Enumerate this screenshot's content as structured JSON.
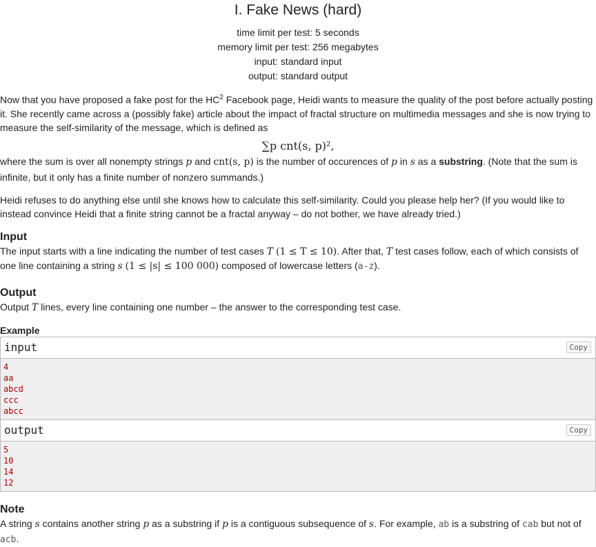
{
  "problem": {
    "title": "I. Fake News (hard)",
    "time_limit": "time limit per test: 5 seconds",
    "memory_limit": "memory limit per test: 256 megabytes",
    "input": "input: standard input",
    "output": "output: standard output"
  },
  "statement": {
    "p1a": "Now that you have proposed a fake post for the HC",
    "p1sup": "2",
    "p1b": " Facebook page, Heidi wants to measure the quality of the post before actually posting it. She recently came across a (possibly fake) article about the impact of fractal structure on multimedia messages and she is now trying to measure the self-similarity of the message, which is defined as",
    "formula": "∑p cnt(s, p)²,",
    "p2a": "where the sum is over all nonempty strings ",
    "p2var_p": "p",
    "p2b": " and ",
    "p2cnt": "cnt(s, p)",
    "p2c": " is the number of occurences of ",
    "p2d": " in ",
    "p2var_s": "s",
    "p2e": " as a ",
    "p2bold": "substring",
    "p2f": ". (Note that the sum is infinite, but it only has a finite number of nonzero summands.)",
    "p3": "Heidi refuses to do anything else until she knows how to calculate this self-similarity. Could you please help her? (If you would like to instead convince Heidi that a finite string cannot be a fractal anyway – do not bother, we have already tried.)"
  },
  "input_section": {
    "title": "Input",
    "a": "The input starts with a line indicating the number of test cases ",
    "T": "T",
    "cond1": "(1 ≤ T ≤ 10)",
    "b": ". After that, ",
    "c": " test cases follow, each of which consists of one line containing a string ",
    "s": "s",
    "cond2": "(1 ≤ |s| ≤ 100 000)",
    "d": " composed of lowercase letters (",
    "az": "a-z",
    "e": ")."
  },
  "output_section": {
    "title": "Output",
    "a": "Output ",
    "T": "T",
    "b": " lines, every line containing one number – the answer to the corresponding test case."
  },
  "example": {
    "title": "Example",
    "input_label": "input",
    "output_label": "output",
    "copy_label": "Copy",
    "input_lines": [
      "4",
      "aa",
      "abcd",
      "ccc",
      "abcc"
    ],
    "output_lines": [
      "5",
      "10",
      "14",
      "12"
    ]
  },
  "note": {
    "title": "Note",
    "a": "A string ",
    "s": "s",
    "b": " contains another string ",
    "p": "p",
    "c": " as a substring if ",
    "d": " is a contiguous subsequence of ",
    "e": ". For example, ",
    "ab": "ab",
    "f": " is a substring of ",
    "cab": "cab",
    "g": " but not of ",
    "acb": "acb",
    "h": "."
  }
}
